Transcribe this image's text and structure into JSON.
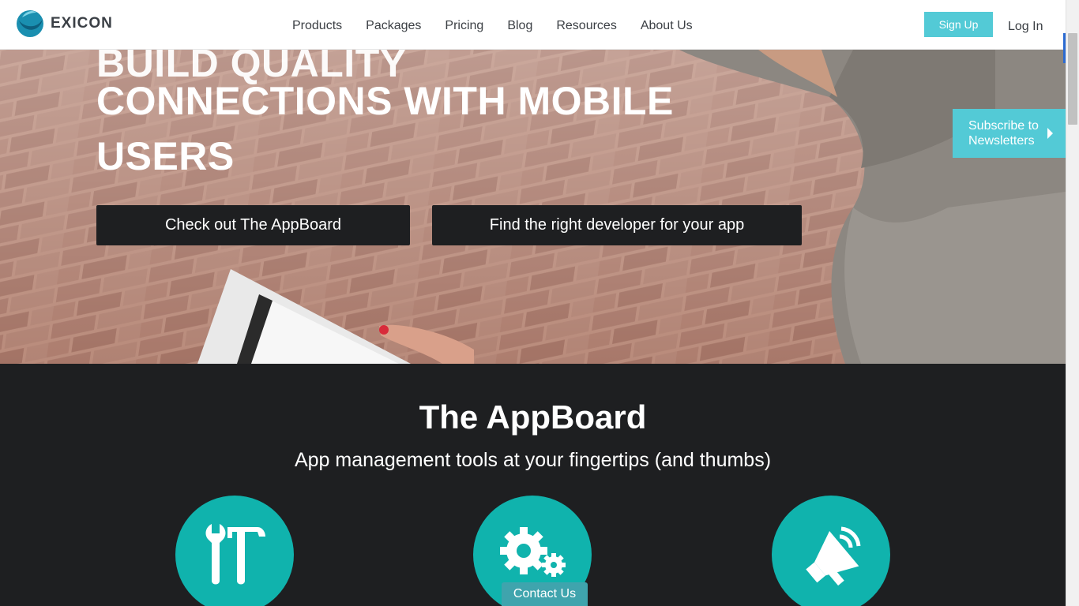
{
  "brand": {
    "name": "Exicon",
    "logo_text": "EXICON"
  },
  "nav": {
    "items": [
      "Products",
      "Packages",
      "Pricing",
      "Blog",
      "Resources",
      "About Us"
    ],
    "signup_label": "Sign Up",
    "login_label": "Log In"
  },
  "hero": {
    "title_partial": "BUILD QUALITY",
    "title_line2": "CONNECTIONS WITH MOBILE",
    "title_line3": "USERS",
    "button_appboard": "Check out The AppBoard",
    "button_developer": "Find the right developer for your app"
  },
  "subscribe": {
    "line1": "Subscribe to",
    "line2": "Newsletters"
  },
  "appboard": {
    "title": "The AppBoard",
    "subtitle": "App management tools at your fingertips (and thumbs)",
    "features": [
      {
        "icon": "tools-icon"
      },
      {
        "icon": "gears-icon"
      },
      {
        "icon": "megaphone-icon"
      }
    ]
  },
  "contact_label": "Contact Us",
  "colors": {
    "accent": "#53cad6",
    "teal": "#10b3ad",
    "dark": "#1e1f21"
  }
}
